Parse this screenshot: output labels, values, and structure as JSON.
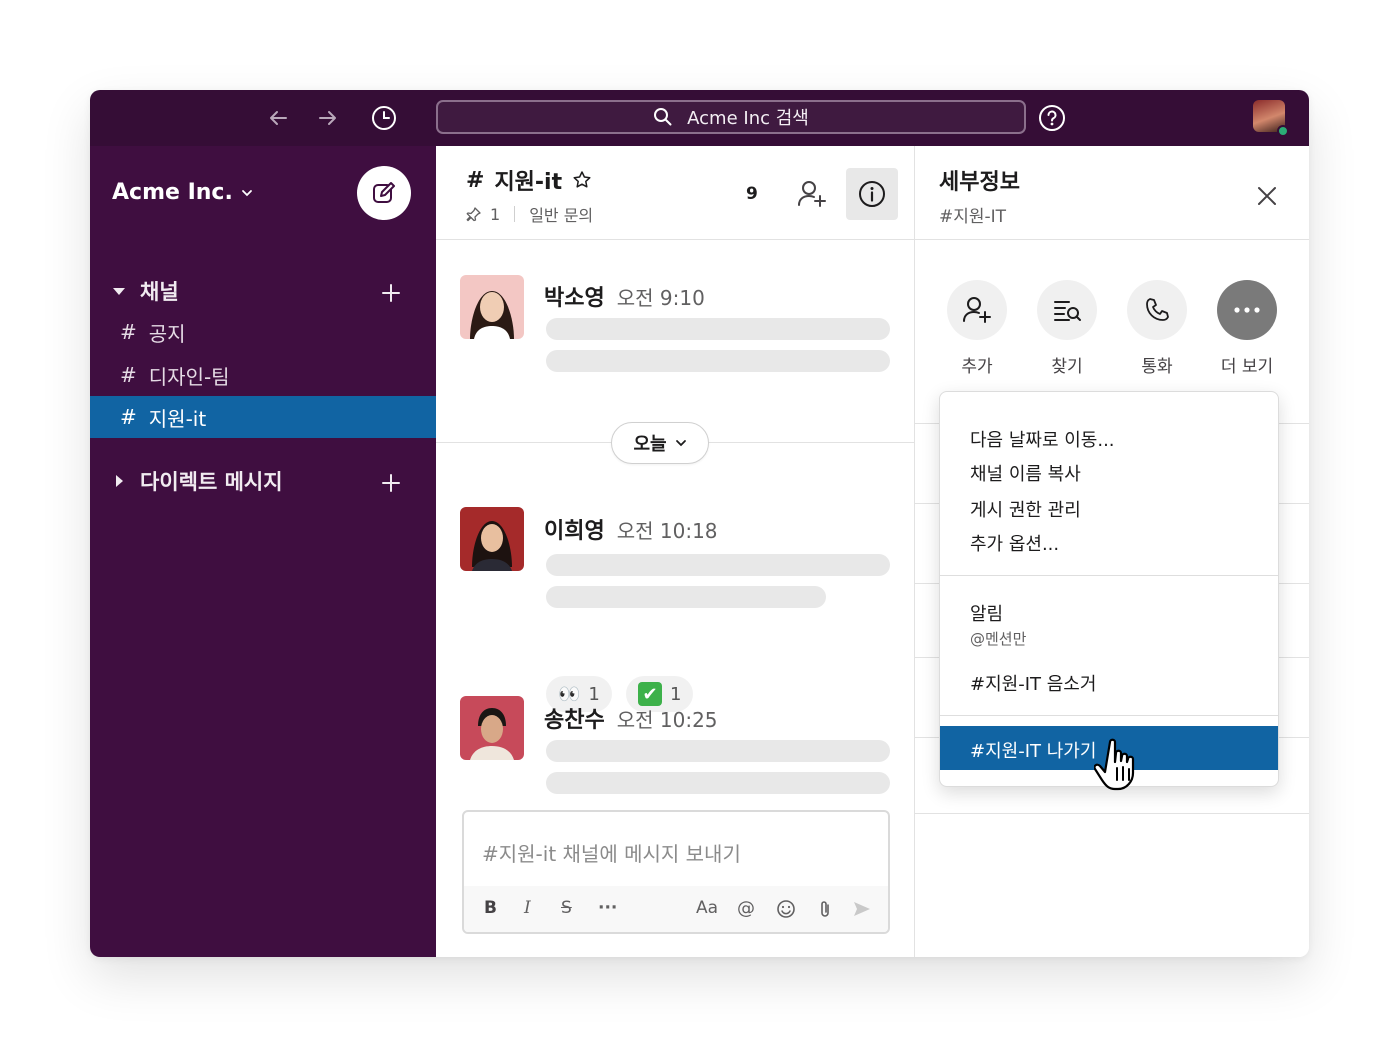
{
  "topbar": {
    "search_text": "Acme Inc 검색",
    "icons": [
      "arrow-left-icon",
      "arrow-right-icon",
      "clock-icon",
      "search-icon",
      "help-icon"
    ]
  },
  "sidebar": {
    "workspace": "Acme Inc.",
    "channels_header": "채널",
    "channels": [
      {
        "hash": "#",
        "name": "공지"
      },
      {
        "hash": "#",
        "name": "디자인-팀"
      },
      {
        "hash": "#",
        "name": "지원-it"
      }
    ],
    "dm_header": "다이렉트 메시지"
  },
  "channel": {
    "hash": "#",
    "name": "지원-it",
    "pins": "1",
    "topic": "일반 문의",
    "member_count": "9"
  },
  "messages": [
    {
      "name": "박소영",
      "time": "오전 9:10"
    },
    {
      "name": "이희영",
      "time": "오전 10:18"
    },
    {
      "name": "송찬수",
      "time": "오전 10:25"
    }
  ],
  "day_divider": "오늘",
  "reactions": [
    {
      "emoji": "👀",
      "count": "1"
    },
    {
      "emoji": "✔",
      "count": "1"
    }
  ],
  "composer": {
    "placeholder": "#지원-it 채널에 메시지 보내기",
    "bold": "B",
    "italic": "I",
    "strike": "S",
    "more": "···",
    "font": "Aa",
    "mention": "@"
  },
  "details": {
    "title": "세부정보",
    "subtitle": "#지원-IT",
    "actions": [
      {
        "label": "추가"
      },
      {
        "label": "찾기"
      },
      {
        "label": "통화"
      },
      {
        "label": "더 보기"
      }
    ]
  },
  "menu": {
    "items_1": [
      "다음 날짜로 이동...",
      "채널 이름 복사",
      "게시 권한 관리",
      "추가 옵션..."
    ],
    "notifications_label": "알림",
    "notifications_value": "@멘션만",
    "mute": "#지원-IT 음소거",
    "leave": "#지원-IT 나가기"
  },
  "colors": {
    "topbar": "#350d36",
    "sidebar": "#3f0e40",
    "active": "#1164a3",
    "online": "#2bac76"
  }
}
